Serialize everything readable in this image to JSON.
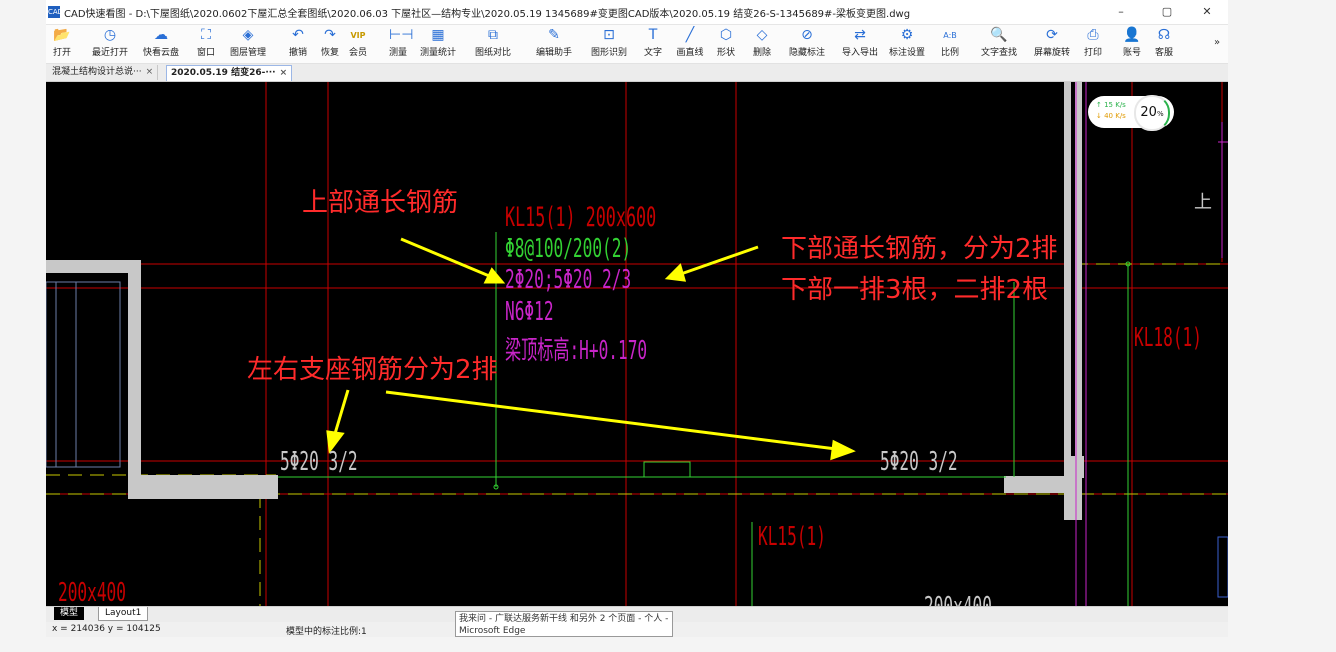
{
  "window": {
    "app_icon": "CAD",
    "title": "CAD快速看图 - D:\\下屋图纸\\2020.0602下屋汇总全套图纸\\2020.06.03 下屋社区—结构专业\\2020.05.19 1345689#变更图CAD版本\\2020.05.19 结变26-S-1345689#-梁板变更图.dwg",
    "minimize": "–",
    "maximize": "▢",
    "close": "✕"
  },
  "toolbar": {
    "items": [
      {
        "label": "打开",
        "icon": "folder-open-icon",
        "glyph": "📂"
      },
      {
        "label": "最近打开",
        "icon": "clock-icon",
        "glyph": "◷"
      },
      {
        "label": "快看云盘",
        "icon": "cloud-icon",
        "glyph": "☁"
      },
      {
        "label": "窗口",
        "icon": "window-icon",
        "glyph": "⛶"
      },
      {
        "label": "图层管理",
        "icon": "layers-icon",
        "glyph": "◈"
      },
      {
        "label": "撤销",
        "icon": "undo-icon",
        "glyph": "↶"
      },
      {
        "label": "恢复",
        "icon": "redo-icon",
        "glyph": "↷"
      },
      {
        "label": "会员",
        "icon": "vip-icon",
        "glyph": "VIP"
      },
      {
        "label": "测量",
        "icon": "measure-icon",
        "glyph": "⊢⊣"
      },
      {
        "label": "测量统计",
        "icon": "measure-stats-icon",
        "glyph": "▦"
      },
      {
        "label": "图纸对比",
        "icon": "compare-icon",
        "glyph": "⧉"
      },
      {
        "label": "编辑助手",
        "icon": "edit-assistant-icon",
        "glyph": "✎"
      },
      {
        "label": "图形识别",
        "icon": "shape-recognition-icon",
        "glyph": "⊡"
      },
      {
        "label": "文字",
        "icon": "text-icon",
        "glyph": "T"
      },
      {
        "label": "画直线",
        "icon": "line-icon",
        "glyph": "╱"
      },
      {
        "label": "形状",
        "icon": "shape-icon",
        "glyph": "⬡"
      },
      {
        "label": "删除",
        "icon": "eraser-icon",
        "glyph": "◇"
      },
      {
        "label": "隐藏标注",
        "icon": "hide-icon",
        "glyph": "⊘"
      },
      {
        "label": "导入导出",
        "icon": "import-export-icon",
        "glyph": "⇄"
      },
      {
        "label": "标注设置",
        "icon": "annotation-settings-icon",
        "glyph": "⚙"
      },
      {
        "label": "比例",
        "icon": "scale-icon",
        "glyph": "A:B"
      },
      {
        "label": "文字查找",
        "icon": "text-search-icon",
        "glyph": "🔍"
      },
      {
        "label": "屏幕旋转",
        "icon": "rotate-icon",
        "glyph": "⟳"
      },
      {
        "label": "打印",
        "icon": "printer-icon",
        "glyph": "⎙"
      },
      {
        "label": "账号",
        "icon": "user-icon",
        "glyph": "👤"
      },
      {
        "label": "客服",
        "icon": "headset-icon",
        "glyph": "☊"
      }
    ],
    "more": "»"
  },
  "tabs": [
    {
      "label": "混凝土结构设计总说···",
      "close": "×"
    },
    {
      "label": "2020.05.19 结变26-···",
      "close": "×"
    }
  ],
  "annotations": {
    "top_rebar": "上部通长钢筋",
    "bottom_rebar_line1": "下部通长钢筋，分为2排",
    "bottom_rebar_line2": "下部一排3根，二排2根",
    "support_rebar": "左右支座钢筋分为2排"
  },
  "drawing": {
    "beam_id": "KL15(1) 200x600",
    "stirrup": "Φ8@100/200(2)",
    "main_rebar": "2Φ20;5Φ20 2/3",
    "side_rebar": "N6Φ12",
    "elevation": "梁顶标高:H+0.170",
    "left_support": "5Φ20 3/2",
    "right_support": "5Φ20 3/2",
    "kl18": "KL18(1)",
    "kl15_lower": "KL15(1)",
    "bottom_left": "200x400",
    "bottom_right": "200x400",
    "right_edge_char": "上",
    "colors": {
      "red": "#ff2b2b",
      "green": "#33d233",
      "magenta": "#c825c8",
      "yellow": "#ffff00",
      "grid_red": "#c80000",
      "wall_gray": "#c8c8c8",
      "cad_red": "#e03030"
    }
  },
  "speed_widget": {
    "up": "↑ 15 K/s",
    "down": "↓ 40 K/s",
    "percent": "20",
    "percent_unit": "%"
  },
  "layout_tabs": {
    "model": "模型",
    "layout1": "Layout1"
  },
  "status": {
    "coords": "x = 214036  y = 104125",
    "scale": "模型中的标注比例:1"
  },
  "popup": {
    "line1": "我来问 - 广联达服务新干线 和另外 2 个页面 - 个人 -",
    "line2": "Microsoft Edge"
  }
}
